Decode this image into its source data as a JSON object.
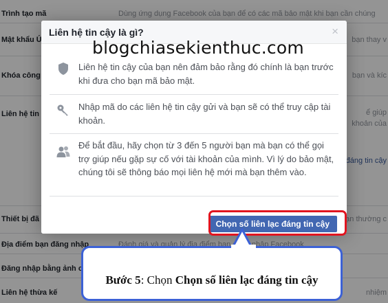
{
  "background": {
    "rows": [
      {
        "label": "Trình tạo mã",
        "desc": "Dùng ứng dụng Facebook của bạn để có các mã bảo mật khi bạn cần chúng",
        "right": ""
      },
      {
        "label": "Mật khẩu Ứ",
        "desc": "",
        "right": "bạn thay v"
      },
      {
        "label": "Khóa công",
        "desc": "",
        "right": "bạn và kíc"
      },
      {
        "label": "Liên hệ tin",
        "desc": "",
        "right": "ể giúp"
      },
      {
        "label": "",
        "desc": "",
        "right": "khoản của"
      },
      {
        "label": "",
        "desc": "",
        "right": "đáng tin cậy",
        "link": true
      },
      {
        "label": "Thiết bị đã",
        "desc": "",
        "right": "bạn thường c"
      },
      {
        "label": "Địa điểm bạn đăng nhập",
        "desc": "Đánh giá và quản lý địa điểm bạn đăng nhập Facebook",
        "right": ""
      },
      {
        "label": "Đăng nhập bằng ảnh c",
        "desc": "",
        "right": ""
      },
      {
        "label": "Liên hệ thừa kế",
        "desc": "",
        "right": "nhiệm"
      }
    ]
  },
  "dialog": {
    "title": "Liên hệ tin cậy là gì?",
    "close_glyph": "×",
    "watermark": "blogchiasekienthuc.com",
    "items": [
      {
        "icon": "shield-icon",
        "text": "Liên hệ tin cậy của bạn nên đảm bảo rằng đó chính là bạn trước khi đưa cho bạn mã bảo mật."
      },
      {
        "icon": "key-icon",
        "text": "Nhập mã do các liên hệ tin cậy gửi và bạn sẽ có thể truy cập tài khoản."
      },
      {
        "icon": "friends-icon",
        "text": "Để bắt đầu, hãy chọn từ 3 đến 5 người bạn mà bạn có thể gọi trợ giúp nếu gặp sự cố với tài khoản của mình. Vì lý do bảo mật, chúng tôi sẽ thông báo mọi liên hệ mới mà bạn thêm vào."
      }
    ],
    "primary_button": "Chọn số liên lạc đáng tin cậy"
  },
  "callout": {
    "step": "Bước 5",
    "middle": ": Chọn ",
    "action": "Chọn số liên lạc đáng tin cậy"
  },
  "colors": {
    "accent": "#4267b2",
    "highlight": "#e1141f",
    "callout_border": "#3c61d6"
  }
}
